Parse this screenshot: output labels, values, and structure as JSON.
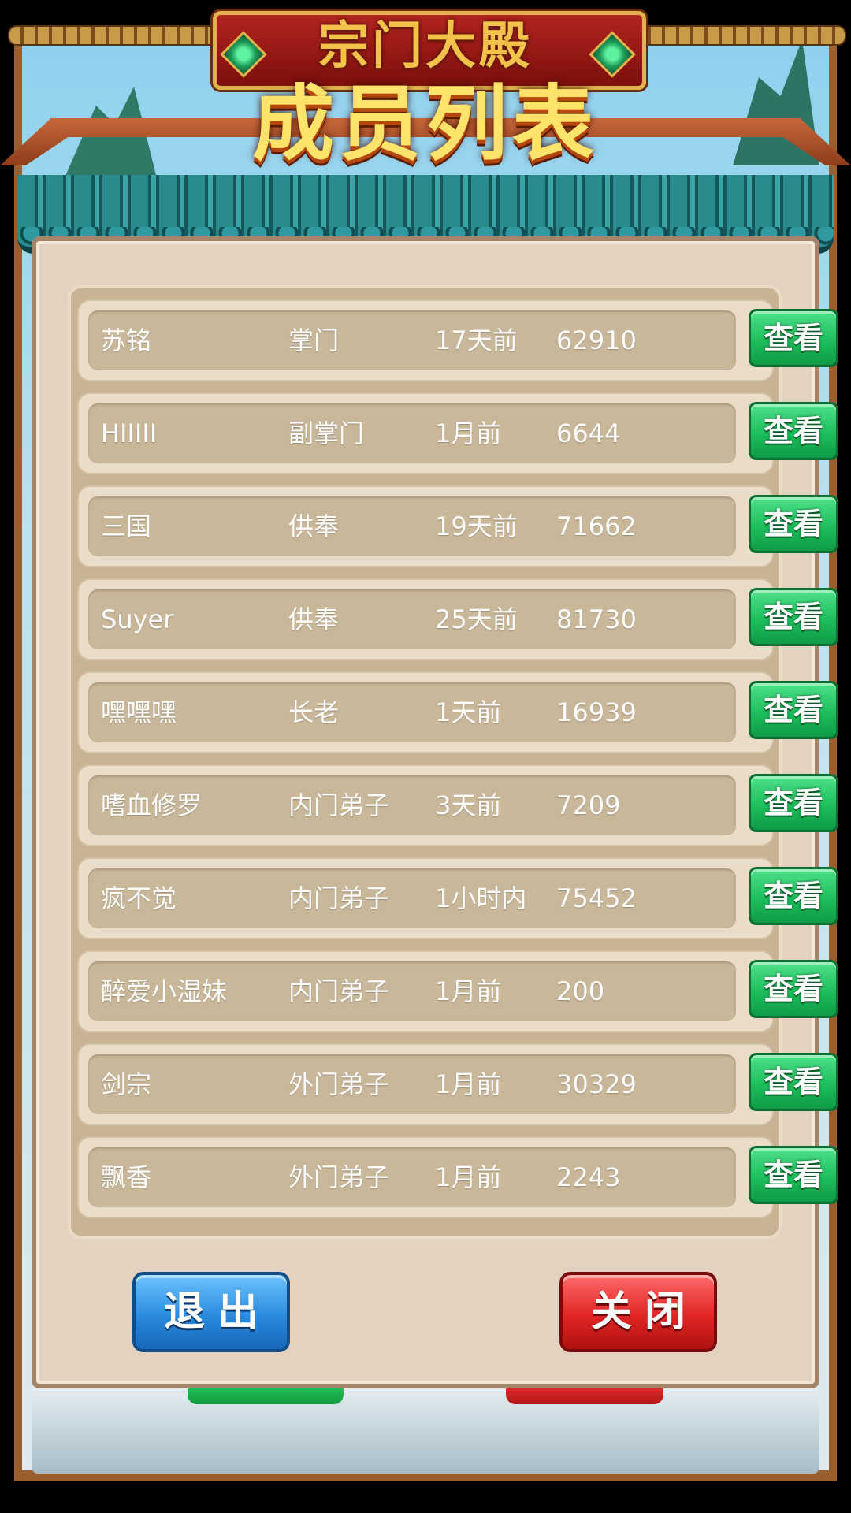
{
  "header": {
    "subtitle": "宗门大殿",
    "title": "成员列表"
  },
  "members": [
    {
      "name": "苏铭",
      "rank": "掌门",
      "last_online": "17天前",
      "score": "62910",
      "action": "查看"
    },
    {
      "name": "HIIIII",
      "rank": "副掌门",
      "last_online": "1月前",
      "score": "6644",
      "action": "查看"
    },
    {
      "name": "三国",
      "rank": "供奉",
      "last_online": "19天前",
      "score": "71662",
      "action": "查看"
    },
    {
      "name": "Suyer",
      "rank": "供奉",
      "last_online": "25天前",
      "score": "81730",
      "action": "查看"
    },
    {
      "name": "嘿嘿嘿",
      "rank": "长老",
      "last_online": "1天前",
      "score": "16939",
      "action": "查看"
    },
    {
      "name": "嗜血修罗",
      "rank": "内门弟子",
      "last_online": "3天前",
      "score": "7209",
      "action": "查看"
    },
    {
      "name": "疯不觉",
      "rank": "内门弟子",
      "last_online": "1小时内",
      "score": "75452",
      "action": "查看"
    },
    {
      "name": "醉爱小湿妹",
      "rank": "内门弟子",
      "last_online": "1月前",
      "score": "200",
      "action": "查看"
    },
    {
      "name": "剑宗",
      "rank": "外门弟子",
      "last_online": "1月前",
      "score": "30329",
      "action": "查看"
    },
    {
      "name": "飘香",
      "rank": "外门弟子",
      "last_online": "1月前",
      "score": "2243",
      "action": "查看"
    }
  ],
  "footer": {
    "exit_label": "退出",
    "close_label": "关闭"
  },
  "colors": {
    "panel": "#e3d2c0",
    "view_button": "#1cbf5c",
    "exit_button": "#2a8be0",
    "close_button": "#e12525",
    "title": "#ffe36a"
  }
}
